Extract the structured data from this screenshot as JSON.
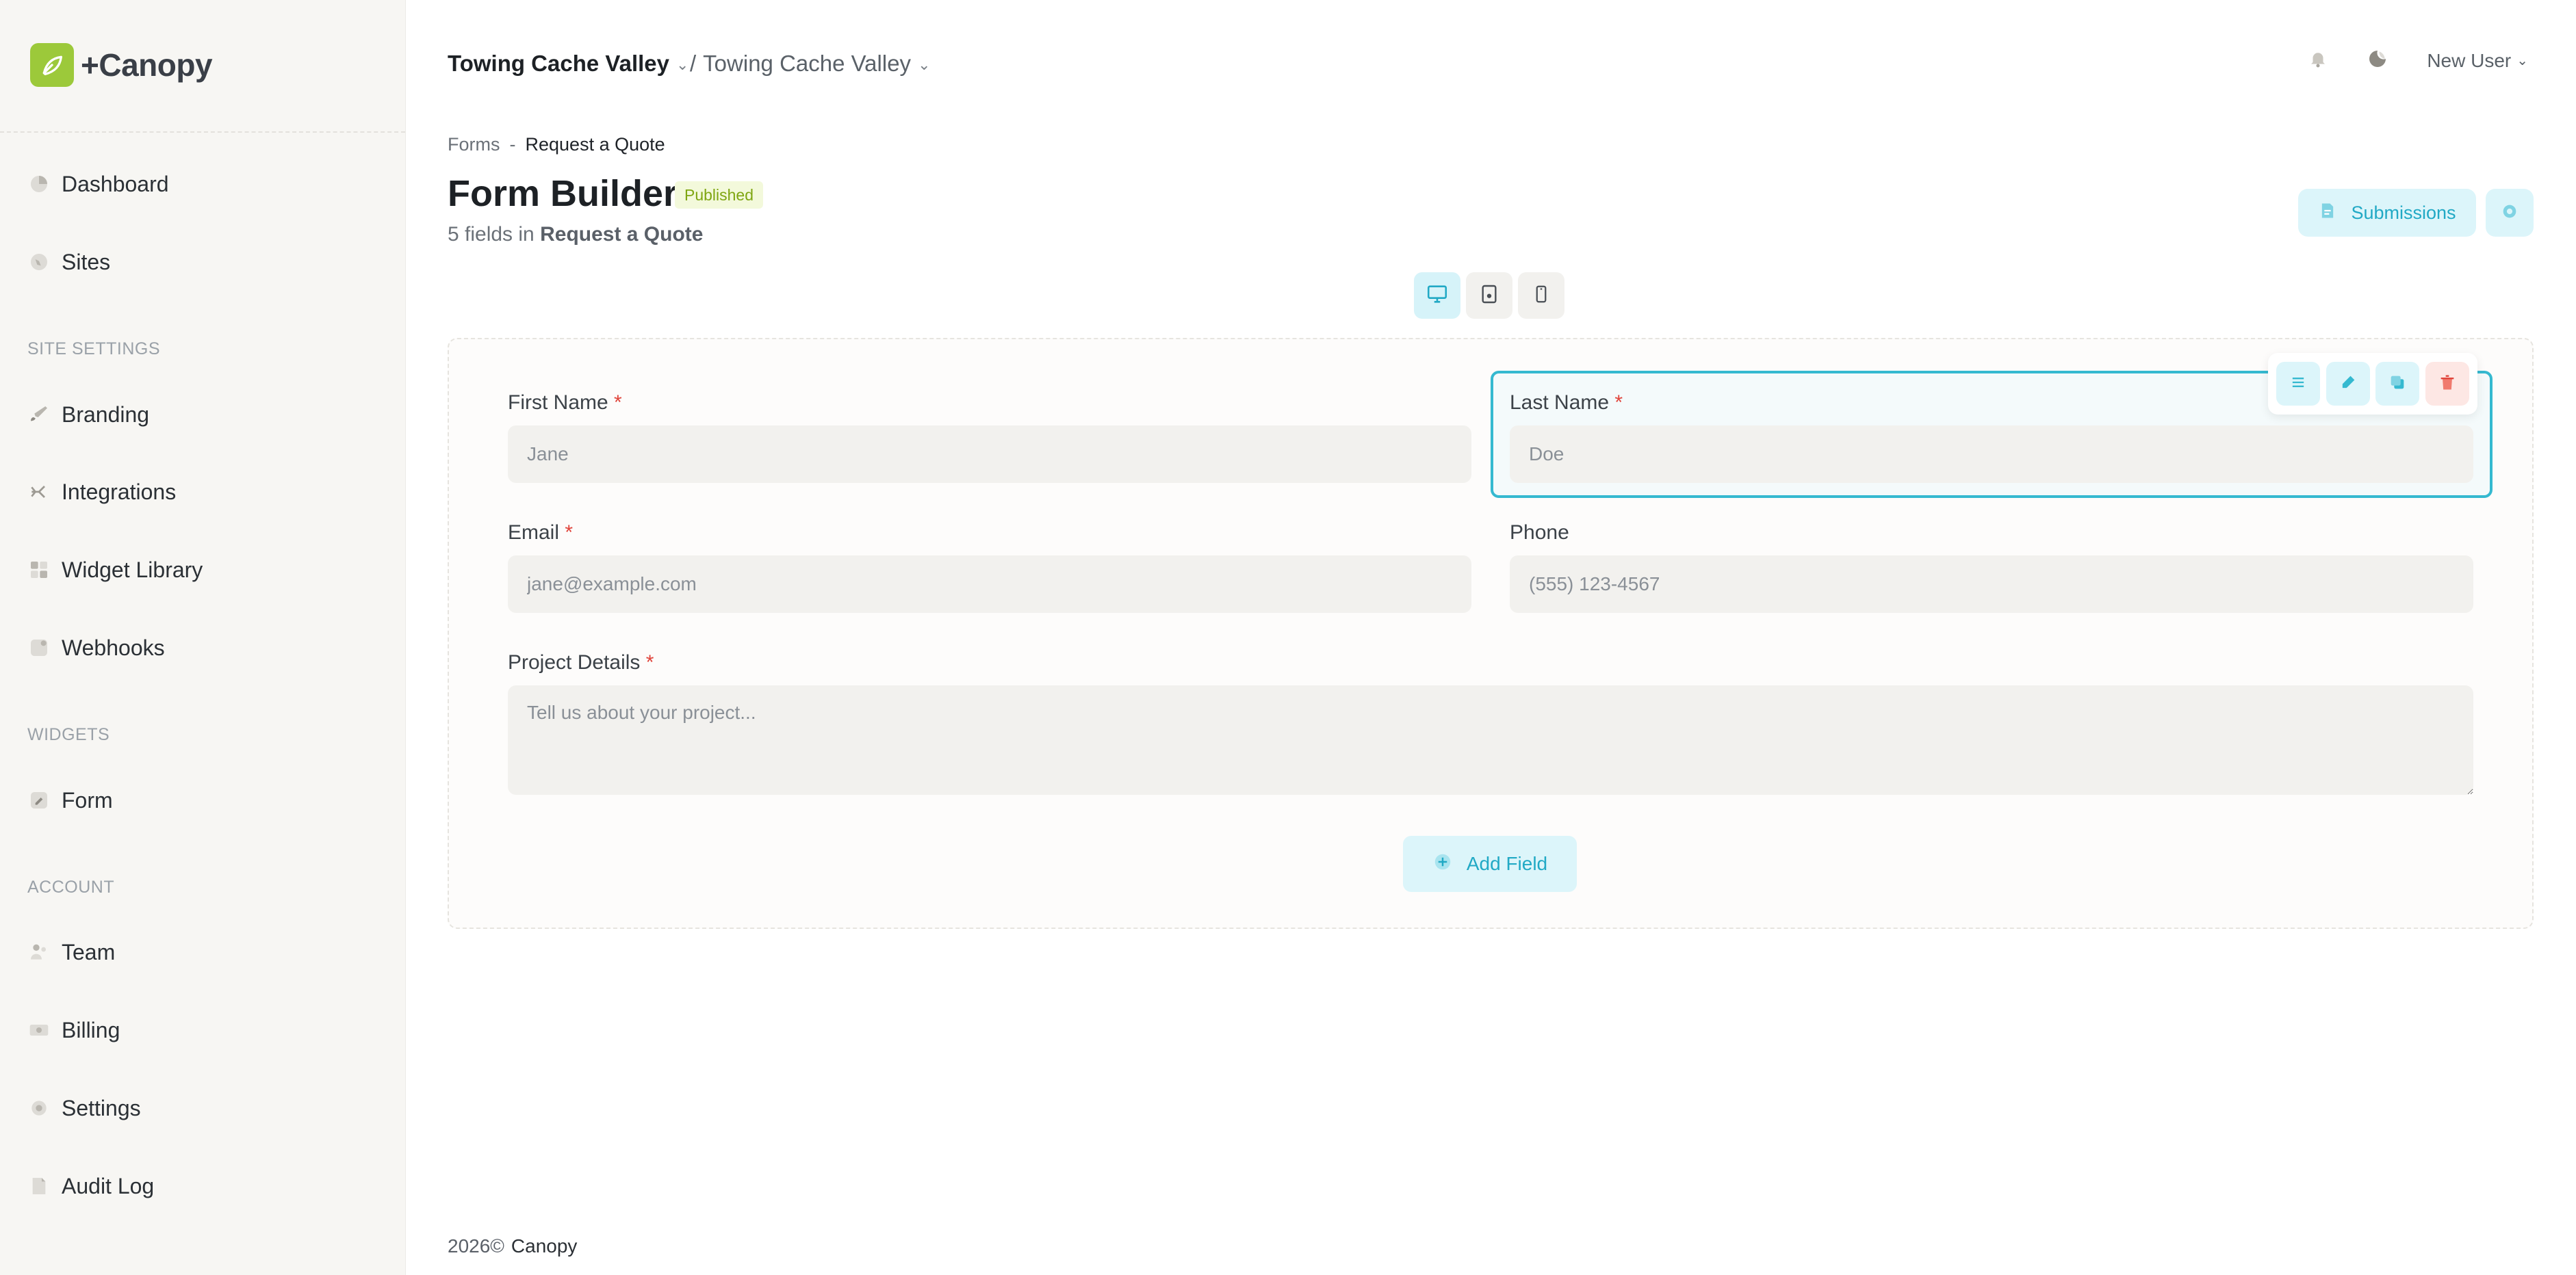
{
  "brand": {
    "name": "+Canopy"
  },
  "sidebar": {
    "items_main": [
      {
        "label": "Dashboard",
        "icon": "pie-chart-icon"
      },
      {
        "label": "Sites",
        "icon": "globe-icon"
      }
    ],
    "section_site_settings": "SITE SETTINGS",
    "items_site": [
      {
        "label": "Branding",
        "icon": "brush-icon"
      },
      {
        "label": "Integrations",
        "icon": "plug-icon"
      },
      {
        "label": "Widget Library",
        "icon": "grid-icon"
      },
      {
        "label": "Webhooks",
        "icon": "webhook-icon"
      }
    ],
    "section_widgets": "WIDGETS",
    "items_widgets": [
      {
        "label": "Form",
        "icon": "form-icon"
      }
    ],
    "section_account": "ACCOUNT",
    "items_account": [
      {
        "label": "Team",
        "icon": "team-icon"
      },
      {
        "label": "Billing",
        "icon": "billing-icon"
      },
      {
        "label": "Settings",
        "icon": "gear-icon"
      },
      {
        "label": "Audit Log",
        "icon": "document-icon"
      }
    ]
  },
  "header": {
    "org": "Towing Cache Valley",
    "separator": "/",
    "site": "Towing Cache Valley",
    "user": "New User"
  },
  "page": {
    "breadcrumb_parent": "Forms",
    "breadcrumb_sep": "-",
    "breadcrumb_current": "Request a Quote",
    "title": "Form Builder",
    "status": "Published",
    "subtitle_prefix": "5 fields in",
    "subtitle_form": "Request a Quote",
    "submissions_label": "Submissions"
  },
  "form": {
    "first_name": {
      "label": "First Name",
      "required": "*",
      "placeholder": "Jane"
    },
    "last_name": {
      "label": "Last Name",
      "required": "*",
      "placeholder": "Doe"
    },
    "email": {
      "label": "Email",
      "required": "*",
      "placeholder": "jane@example.com"
    },
    "phone": {
      "label": "Phone",
      "placeholder": "(555) 123-4567"
    },
    "project_details": {
      "label": "Project Details",
      "required": "*",
      "placeholder": "Tell us about your project..."
    },
    "add_field_label": "Add Field"
  },
  "footer": {
    "year": "2026©",
    "brand": "Canopy"
  },
  "colors": {
    "accent": "#35b9d0",
    "brand": "#9cc93a",
    "danger": "#e0443b"
  }
}
